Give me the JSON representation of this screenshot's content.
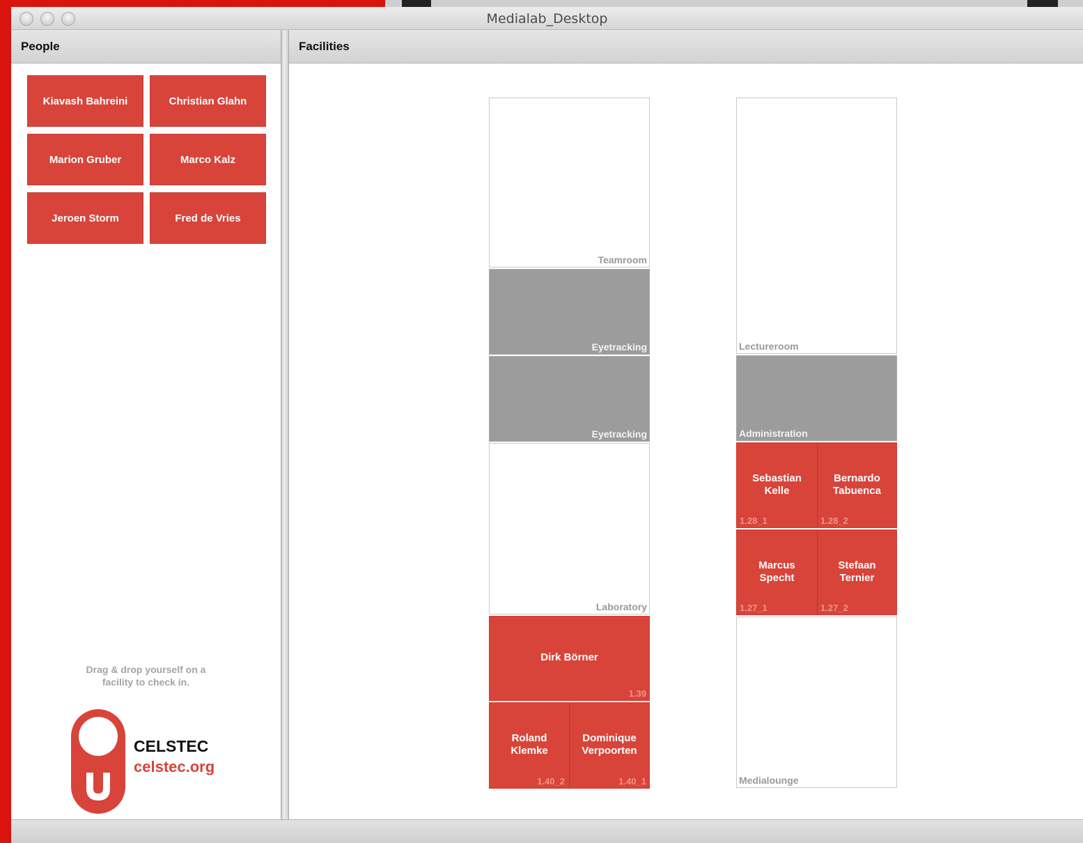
{
  "window": {
    "title": "Medialab_Desktop"
  },
  "people_panel": {
    "header": "People",
    "people": [
      "Kiavash Bahreini",
      "Christian Glahn",
      "Marion Gruber",
      "Marco Kalz",
      "Jeroen Storm",
      "Fred de Vries"
    ],
    "hint_line1": "Drag & drop yourself on a",
    "hint_line2": "facility to check in.",
    "logo_name": "CELSTEC",
    "logo_url": "celstec.org"
  },
  "facilities_panel": {
    "header": "Facilities",
    "teamroom": "Teamroom",
    "eyetracking1": "Eyetracking",
    "eyetracking2": "Eyetracking",
    "laboratory": "Laboratory",
    "room139": {
      "occupant": "Dirk Börner",
      "code": "1.39"
    },
    "room140": {
      "seat_a": {
        "occupant_line1": "Roland",
        "occupant_line2": "Klemke",
        "code": "1.40_2"
      },
      "seat_b": {
        "occupant_line1": "Dominique",
        "occupant_line2": "Verpoorten",
        "code": "1.40_1"
      }
    },
    "lectureroom": "Lectureroom",
    "administration": "Administration",
    "room128": {
      "seat_a": {
        "occupant_line1": "Sebastian",
        "occupant_line2": "Kelle",
        "code": "1.28_1"
      },
      "seat_b": {
        "occupant_line1": "Bernardo",
        "occupant_line2": "Tabuenca",
        "code": "1.28_2"
      }
    },
    "room127": {
      "seat_a": {
        "occupant_line1": "Marcus",
        "occupant_line2": "Specht",
        "code": "1.27_1"
      },
      "seat_b": {
        "occupant_line1": "Stefaan",
        "occupant_line2": "Ternier",
        "code": "1.27_2"
      }
    },
    "medialounge": "Medialounge"
  },
  "colors": {
    "occupied": "#d8443a",
    "inactive": "#9c9c9c",
    "background": "#d9140e"
  },
  "icons": [
    "window-close-icon",
    "window-minimize-icon",
    "window-zoom-icon",
    "celstec-logo-icon"
  ]
}
